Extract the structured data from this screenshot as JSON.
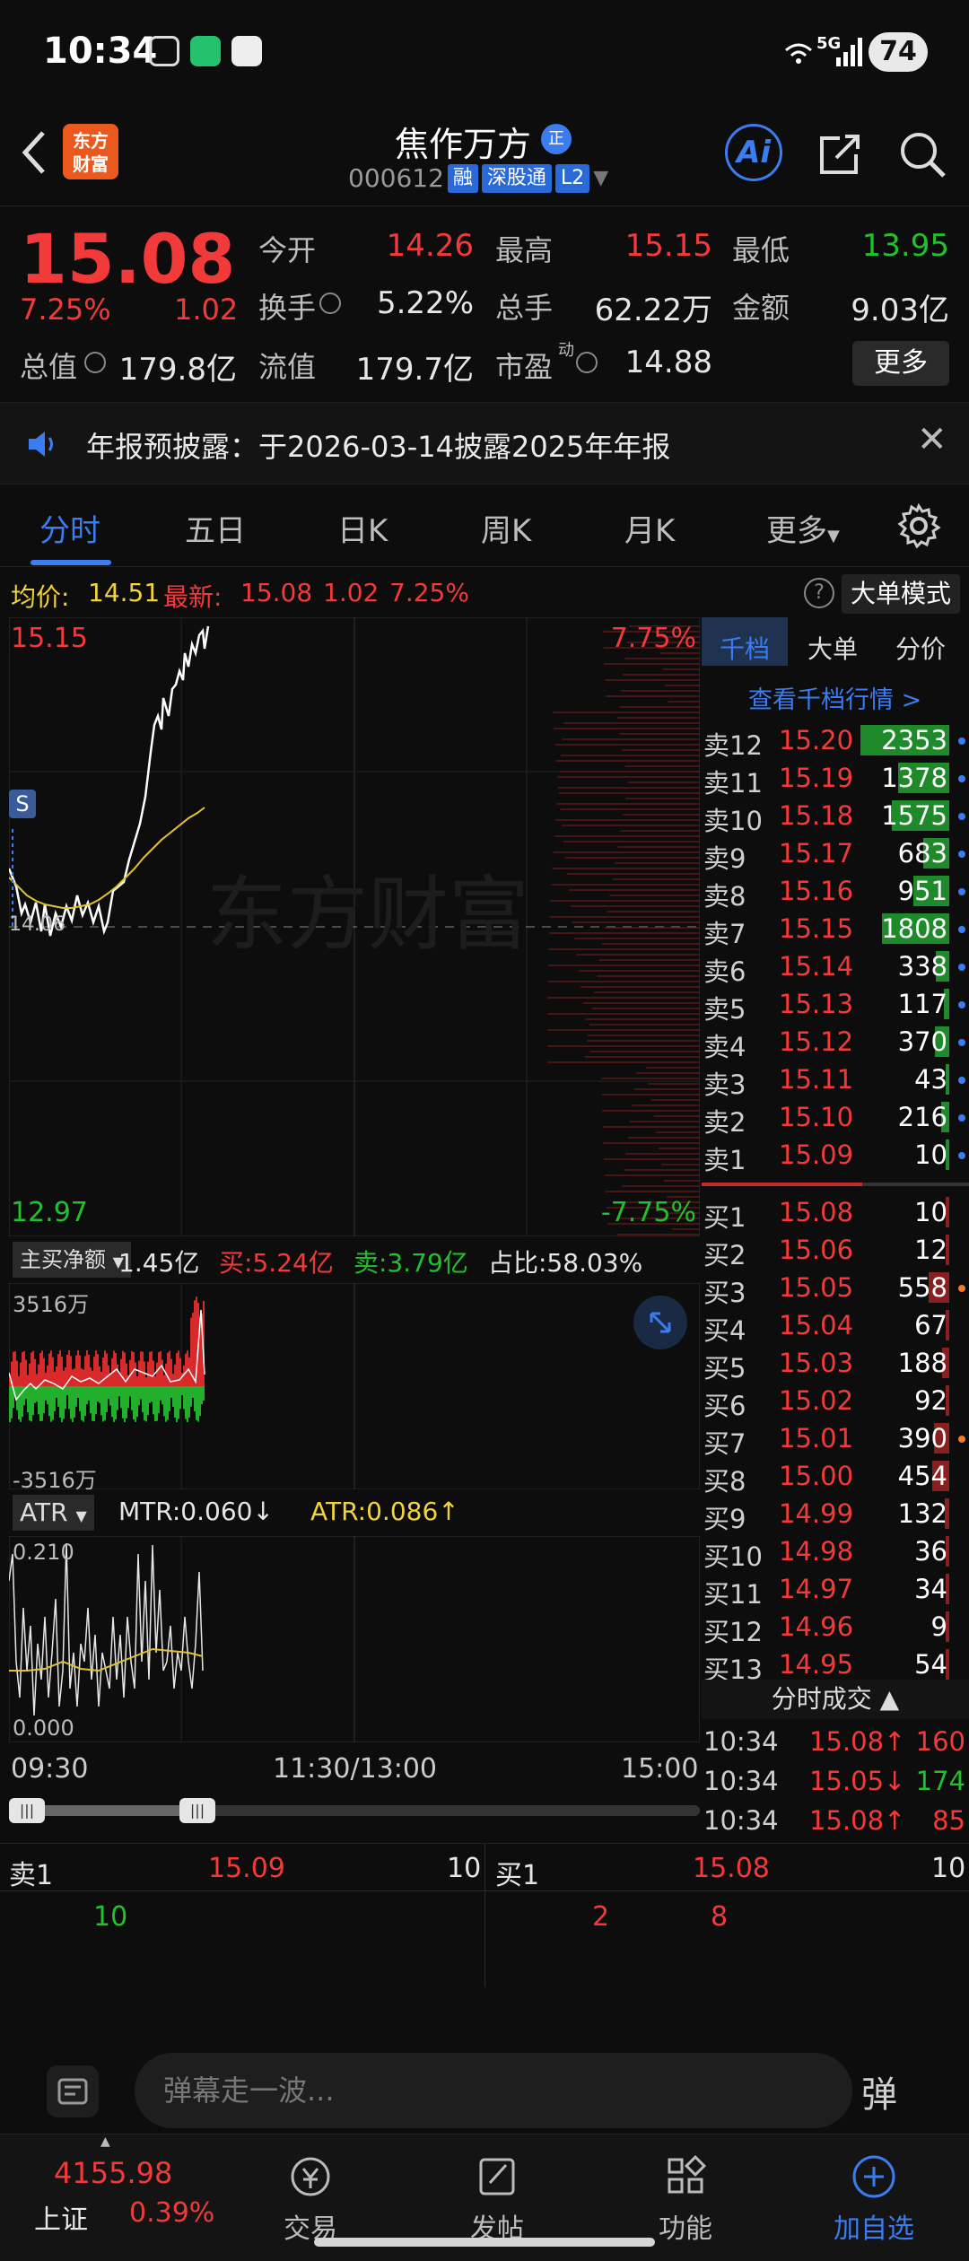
{
  "status_bar": {
    "time": "10:34",
    "network": "5G",
    "battery": "74"
  },
  "header": {
    "logo_text": "东方\n财富",
    "stock_name": "焦作万方",
    "zheng_badge": "正",
    "stock_code": "000612",
    "tags": [
      "融",
      "深股通",
      "L2"
    ],
    "ai_label": "Ai"
  },
  "quote": {
    "price": "15.08",
    "change_pct": "7.25%",
    "change": "1.02",
    "fields": [
      {
        "label": "今开",
        "value": "14.26",
        "color": "red"
      },
      {
        "label": "最高",
        "value": "15.15",
        "color": "red"
      },
      {
        "label": "最低",
        "value": "13.95",
        "color": "green"
      },
      {
        "label": "换手",
        "value": "5.22%",
        "color": "white"
      },
      {
        "label": "总手",
        "value": "62.22万",
        "color": "white"
      },
      {
        "label": "金额",
        "value": "9.03亿",
        "color": "white"
      },
      {
        "label": "总值",
        "value": "179.8亿",
        "color": "white"
      },
      {
        "label": "流值",
        "value": "179.7亿",
        "color": "white"
      },
      {
        "label": "市盈",
        "value": "14.88",
        "color": "white"
      }
    ],
    "pe_super": "动",
    "more_label": "更多"
  },
  "notice": {
    "text": "年报预披露：于2026-03-14披露2025年年报"
  },
  "tabs": [
    "分时",
    "五日",
    "日K",
    "周K",
    "月K",
    "更多"
  ],
  "chart_info": {
    "avg_label": "均价:",
    "avg_value": "14.51",
    "latest_label": "最新:",
    "latest_value": "15.08",
    "latest_change": "1.02",
    "latest_pct": "7.25%",
    "help": "?",
    "big_mode": "大单模式"
  },
  "chart": {
    "top_price": "15.15",
    "bottom_price": "12.97",
    "top_pct": "7.75%",
    "bottom_pct": "-7.75%",
    "marker": "S",
    "open_label": "14.06",
    "watermark": "东方财富"
  },
  "right_panel": {
    "tabs": [
      "千档",
      "大单",
      "分价"
    ],
    "view_link": "查看千档行情 >",
    "sell": [
      {
        "label": "卖12",
        "price": "15.20",
        "vol": "2353",
        "bar": 0.95,
        "dot": "blue"
      },
      {
        "label": "卖11",
        "price": "15.19",
        "vol": "1378",
        "bar": 0.55,
        "dot": "blue"
      },
      {
        "label": "卖10",
        "price": "15.18",
        "vol": "1575",
        "bar": 0.62,
        "dot": "blue"
      },
      {
        "label": "卖9",
        "price": "15.17",
        "vol": "683",
        "bar": 0.28,
        "dot": "blue"
      },
      {
        "label": "卖8",
        "price": "15.16",
        "vol": "951",
        "bar": 0.38,
        "dot": "blue"
      },
      {
        "label": "卖7",
        "price": "15.15",
        "vol": "1808",
        "bar": 0.72,
        "dot": "blue"
      },
      {
        "label": "卖6",
        "price": "15.14",
        "vol": "338",
        "bar": 0.14,
        "dot": "blue"
      },
      {
        "label": "卖5",
        "price": "15.13",
        "vol": "117",
        "bar": 0.06,
        "dot": "blue"
      },
      {
        "label": "卖4",
        "price": "15.12",
        "vol": "370",
        "bar": 0.15,
        "dot": "blue"
      },
      {
        "label": "卖3",
        "price": "15.11",
        "vol": "43",
        "bar": 0.03,
        "dot": "blue"
      },
      {
        "label": "卖2",
        "price": "15.10",
        "vol": "216",
        "bar": 0.09,
        "dot": "blue"
      },
      {
        "label": "卖1",
        "price": "15.09",
        "vol": "10",
        "bar": 0.01,
        "dot": "blue"
      }
    ],
    "buy": [
      {
        "label": "买1",
        "price": "15.08",
        "vol": "10",
        "bar": 0.01,
        "dot": ""
      },
      {
        "label": "买2",
        "price": "15.06",
        "vol": "12",
        "bar": 0.01,
        "dot": ""
      },
      {
        "label": "买3",
        "price": "15.05",
        "vol": "558",
        "bar": 0.22,
        "dot": "orange"
      },
      {
        "label": "买4",
        "price": "15.04",
        "vol": "67",
        "bar": 0.03,
        "dot": ""
      },
      {
        "label": "买5",
        "price": "15.03",
        "vol": "188",
        "bar": 0.08,
        "dot": ""
      },
      {
        "label": "买6",
        "price": "15.02",
        "vol": "92",
        "bar": 0.04,
        "dot": ""
      },
      {
        "label": "买7",
        "price": "15.01",
        "vol": "390",
        "bar": 0.16,
        "dot": "orange"
      },
      {
        "label": "买8",
        "price": "15.00",
        "vol": "454",
        "bar": 0.18,
        "dot": ""
      },
      {
        "label": "买9",
        "price": "14.99",
        "vol": "132",
        "bar": 0.05,
        "dot": ""
      },
      {
        "label": "买10",
        "price": "14.98",
        "vol": "36",
        "bar": 0.02,
        "dot": ""
      },
      {
        "label": "买11",
        "price": "14.97",
        "vol": "34",
        "bar": 0.02,
        "dot": ""
      },
      {
        "label": "买12",
        "price": "14.96",
        "vol": "9",
        "bar": 0.01,
        "dot": ""
      },
      {
        "label": "买13",
        "price": "14.95",
        "vol": "54",
        "bar": 0.02,
        "dot": ""
      }
    ],
    "ticks_header": "分时成交",
    "ticks": [
      {
        "time": "10:34",
        "price": "15.08↑",
        "vol": "160",
        "pcolor": "red",
        "vcolor": "red"
      },
      {
        "time": "10:34",
        "price": "15.05↓",
        "vol": "174",
        "pcolor": "red",
        "vcolor": "green"
      },
      {
        "time": "10:34",
        "price": "15.08↑",
        "vol": "85",
        "pcolor": "red",
        "vcolor": "red"
      }
    ]
  },
  "flow": {
    "dropdown": "主买净额",
    "net": "1.45亿",
    "buy": "买:5.24亿",
    "sell": "卖:3.79亿",
    "ratio": "占比:58.03%",
    "top": "3516万",
    "bottom": "-3516万"
  },
  "atr": {
    "dropdown": "ATR",
    "mtr": "MTR:0.060↓",
    "atr": "ATR:0.086↑",
    "top": "0.210",
    "bottom": "0.000"
  },
  "time_axis": [
    "09:30",
    "11:30/13:00",
    "15:00"
  ],
  "best_quote": {
    "left_label": "卖1",
    "left_price": "15.09",
    "left_vol": "10",
    "right_label": "买1",
    "right_price": "15.08",
    "right_vol": "10",
    "left_detail": [
      "10"
    ],
    "right_detail": [
      "2",
      "8"
    ]
  },
  "danmaku": {
    "placeholder": "弹幕走一波...",
    "btn": "弹"
  },
  "bottom_nav": {
    "index_value": "4155.98",
    "index_name": "上证",
    "index_pct": "0.39%",
    "items": [
      "交易",
      "发帖",
      "功能",
      "加自选"
    ]
  },
  "colors": {
    "red": "#f23a3a",
    "green": "#22c02c",
    "blue": "#3b7cf0",
    "yellow": "#f3d23a",
    "bg": "#0d0d0d"
  }
}
